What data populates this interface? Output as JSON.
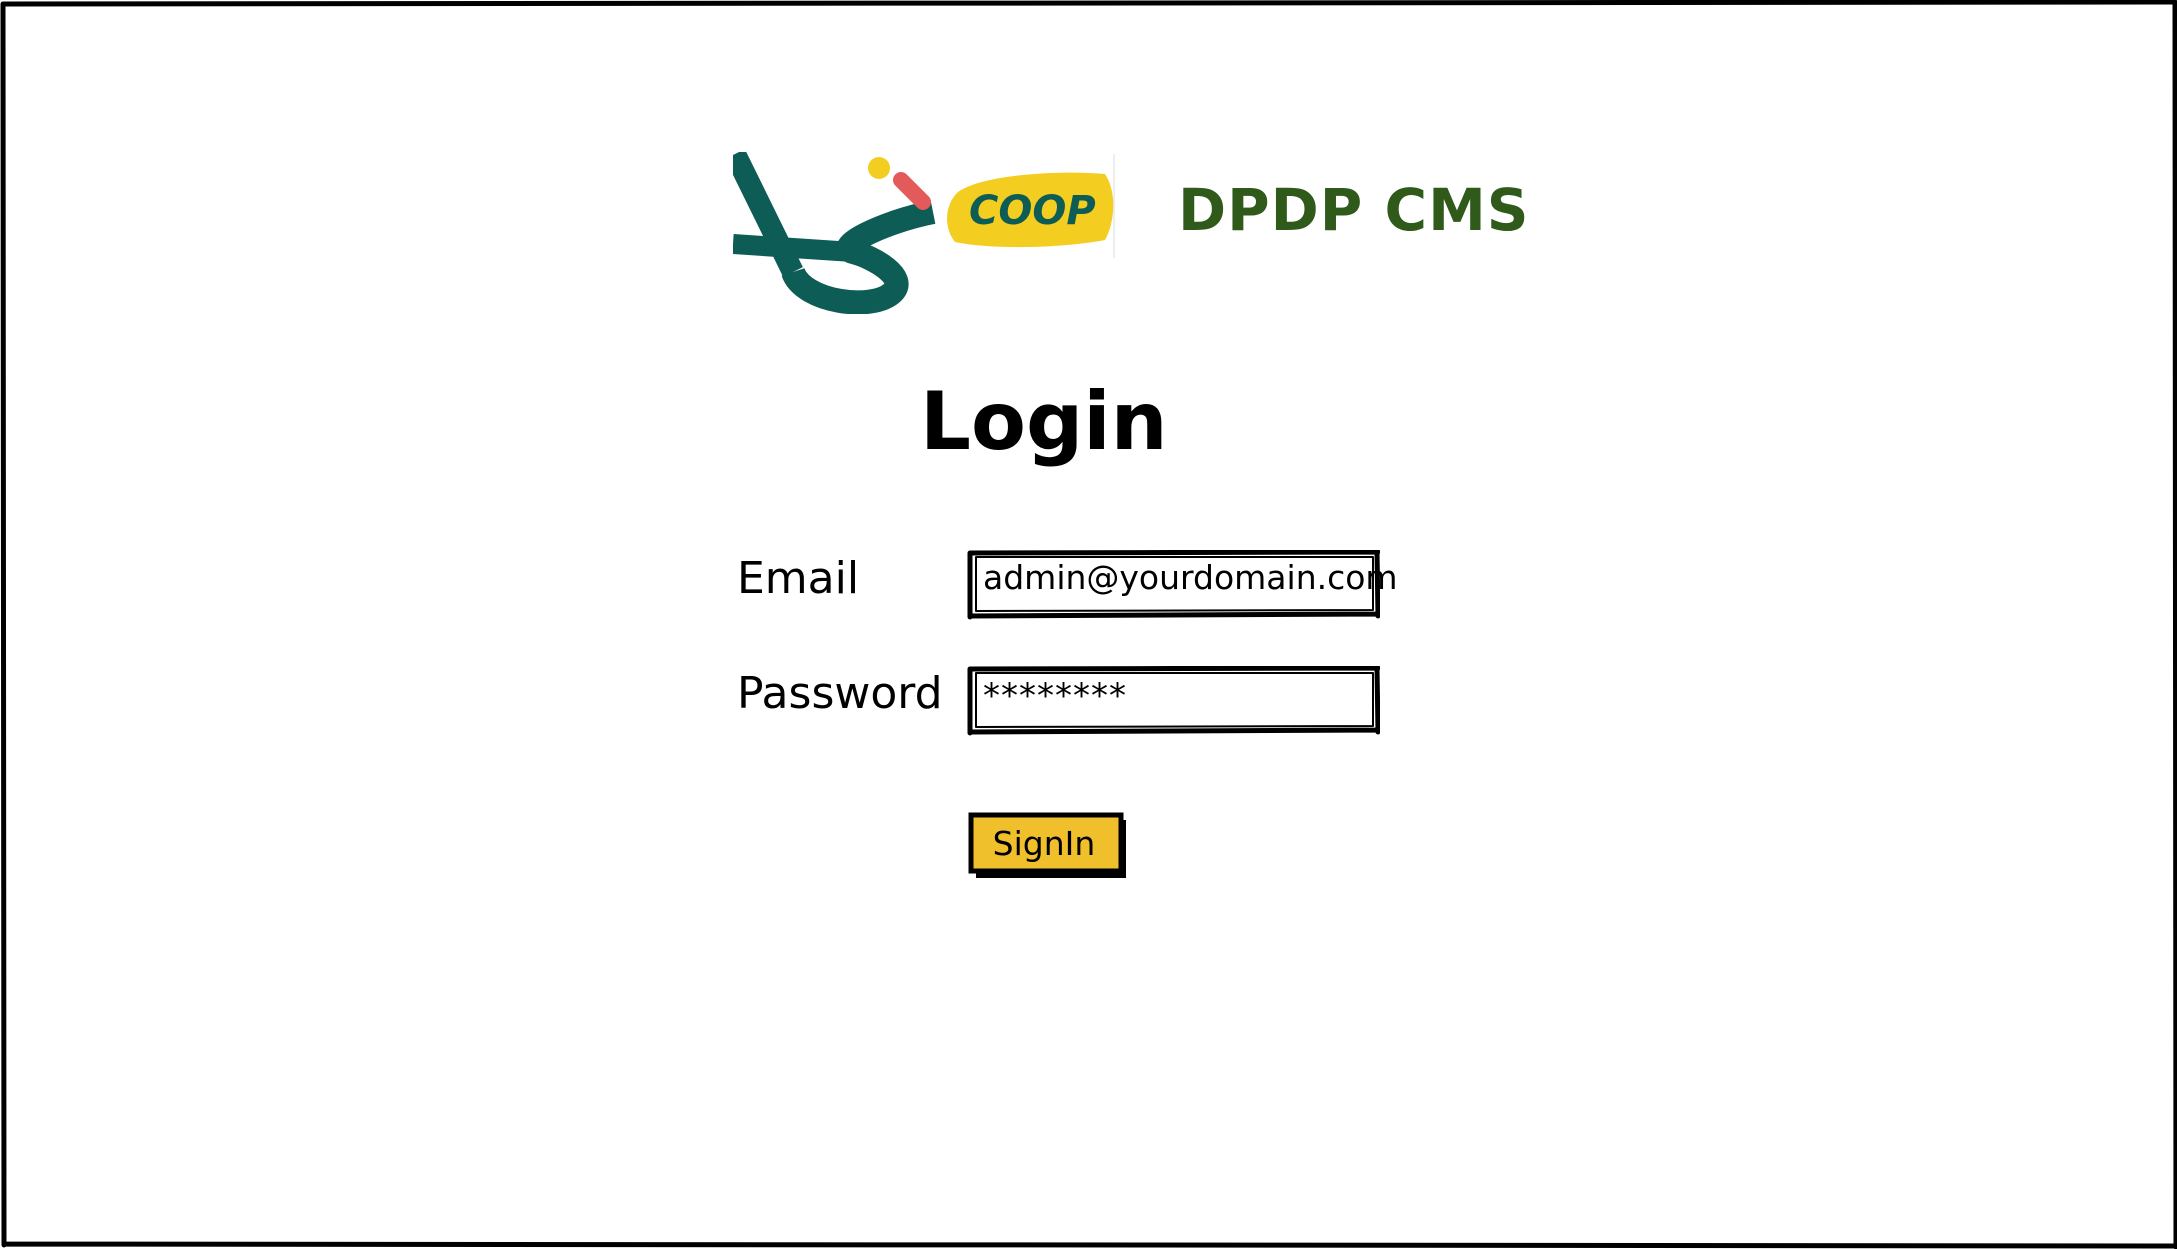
{
  "brand": {
    "logo_text": "COOP",
    "app_title": "DPDP CMS"
  },
  "login": {
    "heading": "Login",
    "email_label": "Email",
    "password_label": "Password",
    "email_value": "admin@yourdomain.com",
    "password_value": "********",
    "signin_label": "SignIn"
  },
  "colors": {
    "title_green": "#2f5a1a",
    "logo_teal": "#0d5c55",
    "logo_yellow": "#f3cd1f",
    "logo_red": "#e35a5a",
    "button_yellow": "#f0c02c"
  }
}
